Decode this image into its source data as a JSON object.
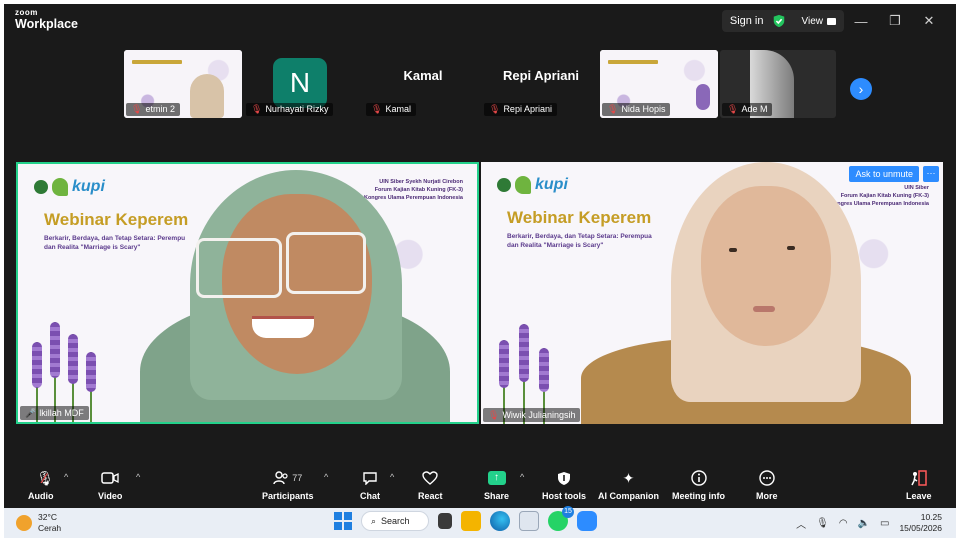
{
  "window": {
    "brand_top": "zoom",
    "brand_bottom": "Workplace",
    "signin_label": "Sign in",
    "view_label": "View",
    "minimize_glyph": "—",
    "restore_glyph": "❐",
    "close_glyph": "✕"
  },
  "thumbnails": [
    {
      "name": "etmin 2",
      "kind": "slide"
    },
    {
      "name": "Nurhayati Rizky",
      "kind": "avatar",
      "initial": "N"
    },
    {
      "name": "Kamal",
      "kind": "name-only",
      "display_name": "Kamal"
    },
    {
      "name": "Repi Apriani",
      "kind": "name-only",
      "display_name": "Repi Apriani"
    },
    {
      "name": "Nida Hopis",
      "kind": "slide"
    },
    {
      "name": "Ade M",
      "kind": "camera"
    }
  ],
  "main_tiles": {
    "left": {
      "name": "lkillah MDF",
      "slide_logo": "kupi",
      "slide_org": [
        "UIN Siber Syekh Nurjati Cirebon",
        "Forum Kajian Kitab Kuning (FK-3)",
        "Kongres Ulama Perempuan Indonesia"
      ],
      "slide_title": "Webinar Keperem",
      "slide_subtitle": "Berkarir, Berdaya, dan Tetap Setara: Perempu\ndan Realita \"Marriage is Scary\""
    },
    "right": {
      "name": "Wiwik Julianingsih",
      "slide_logo": "kupi",
      "slide_org": [
        "UIN Siber",
        "Forum Kajian Kitab Kuning (FK-3)",
        "ongres Ulama Perempuan Indonesia"
      ],
      "slide_title": "Webinar Keperem",
      "slide_subtitle": "Berkarir, Berdaya, dan Tetap Setara: Perempua\ndan Realita \"Marriage is Scary\"",
      "unmute_label": "Ask to unmute",
      "more_label": "···"
    }
  },
  "controls": {
    "audio": "Audio",
    "video": "Video",
    "participants": "Participants",
    "participants_count": "77",
    "chat": "Chat",
    "react": "React",
    "share": "Share",
    "host_tools": "Host tools",
    "ai_companion": "AI Companion",
    "meeting_info": "Meeting info",
    "more": "More",
    "leave": "Leave"
  },
  "taskbar": {
    "temperature": "32°C",
    "condition": "Cerah",
    "search_label": "Search",
    "whatsapp_badge": "15",
    "time": "10.25",
    "date": "15/05/2026"
  },
  "colors": {
    "accent": "#2d8cff",
    "active_speaker": "#23d18b",
    "muted": "#e54848",
    "slide_title": "#c59d25"
  }
}
